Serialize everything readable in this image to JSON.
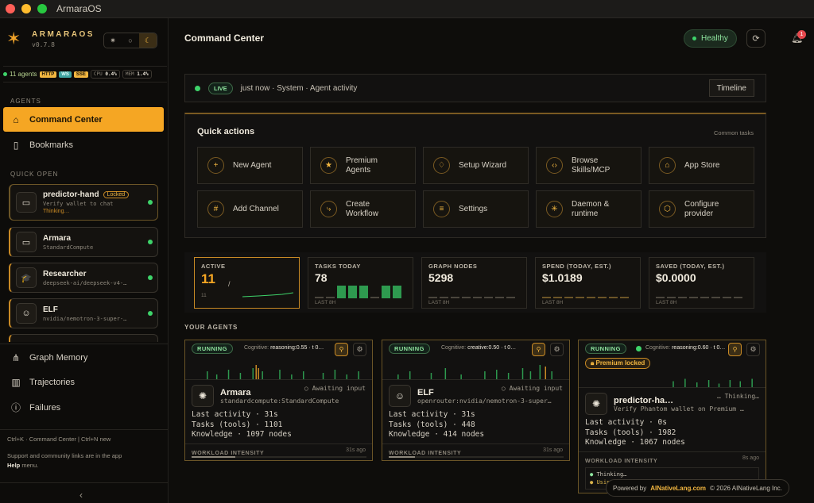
{
  "window": {
    "title": "ArmaraOS"
  },
  "brand": {
    "name": "ARMARAOS",
    "version": "v0.7.8"
  },
  "system": {
    "agents_count": "11 agents",
    "chips": [
      "HTTP",
      "WS",
      "SSE"
    ],
    "cpu_label": "CPU",
    "cpu_value": "0.4%",
    "mem_label": "MEM",
    "mem_value": "1.4%"
  },
  "sidebar": {
    "agents_section": "AGENTS",
    "nav_primary": [
      {
        "label": "Command Center",
        "icon": "home-icon",
        "active": true
      },
      {
        "label": "Bookmarks",
        "icon": "bookmark-icon",
        "active": false
      }
    ],
    "quick_open_section": "QUICK OPEN",
    "quick_open": [
      {
        "name": "predictor-hand",
        "badge": "Locked",
        "sub": "Verify wallet to chat",
        "status": "Thinking…",
        "icon": "chat-icon"
      },
      {
        "name": "Armara",
        "sub": "StandardCompute",
        "icon": "chat-icon"
      },
      {
        "name": "Researcher",
        "sub": "deepseek-ai/deepseek-v4-…",
        "icon": "graduation-cap-icon"
      },
      {
        "name": "ELF",
        "sub": "nvidia/nemotron-3-super-…",
        "icon": "elf-avatar-icon"
      }
    ],
    "nav_secondary": [
      {
        "label": "Graph Memory",
        "icon": "graph-icon"
      },
      {
        "label": "Trajectories",
        "icon": "bar-chart-icon"
      },
      {
        "label": "Failures",
        "icon": "alert-circle-icon"
      }
    ],
    "shortcuts": "Ctrl+K · Command Center | Ctrl+N new",
    "support_text": "Support and community links are in the app",
    "support_bold": "Help",
    "support_tail": " menu."
  },
  "header": {
    "title": "Command Center",
    "health": "Healthy",
    "notifications": "1"
  },
  "live": {
    "pill": "LIVE",
    "text": "just now · System · Agent activity",
    "timeline": "Timeline"
  },
  "quick_actions": {
    "title": "Quick actions",
    "hint": "Common tasks",
    "items": [
      {
        "label": "New Agent",
        "icon": "plus-icon"
      },
      {
        "label": "Premium\nAgents",
        "icon": "star-icon"
      },
      {
        "label": "Setup Wizard",
        "icon": "lightbulb-icon"
      },
      {
        "label": "Browse\nSkills/MCP",
        "icon": "code-icon"
      },
      {
        "label": "App Store",
        "icon": "store-icon"
      },
      {
        "label": "Add Channel",
        "icon": "hash-icon"
      },
      {
        "label": "Create\nWorkflow",
        "icon": "workflow-icon"
      },
      {
        "label": "Settings",
        "icon": "sliders-icon"
      },
      {
        "label": "Daemon &\nruntime",
        "icon": "spinner-icon"
      },
      {
        "label": "Configure\nprovider",
        "icon": "hexagon-icon"
      }
    ]
  },
  "stats": [
    {
      "label": "ACTIVE",
      "value": "11",
      "sub": "11"
    },
    {
      "label": "TASKS TODAY",
      "value": "78",
      "sub": "LAST 8H"
    },
    {
      "label": "GRAPH NODES",
      "value": "5298",
      "sub": "LAST 8H"
    },
    {
      "label": "SPEND (TODAY, EST.)",
      "value": "$1.0189",
      "sub": "LAST 8H"
    },
    {
      "label": "SAVED (TODAY, EST.)",
      "value": "$0.0000",
      "sub": "LAST 8H"
    }
  ],
  "agents_section": "YOUR AGENTS",
  "agents": [
    {
      "status": "RUNNING",
      "cognitive_label": "Cognitive:",
      "cognitive": "reasoning:0.55 · t 0…",
      "name": "Armara",
      "state": "Awaiting input",
      "model": "standardcompute:StandardCompute",
      "last_activity": "Last activity · 31s",
      "tasks": "Tasks (tools) · 1101",
      "knowledge": "Knowledge · 1097 nodes",
      "workload": "WORKLOAD INTENSITY",
      "workload_time": "31s ago",
      "workload_level": 0.25
    },
    {
      "status": "RUNNING",
      "cognitive_label": "Cognitive:",
      "cognitive": "creative:0.50 · t 0…",
      "name": "ELF",
      "state": "Awaiting input",
      "model": "openrouter:nvidia/nemotron-3-super…",
      "last_activity": "Last activity · 31s",
      "tasks": "Tasks (tools) · 448",
      "knowledge": "Knowledge · 414 nodes",
      "workload": "WORKLOAD INTENSITY",
      "workload_time": "31s ago",
      "workload_level": 0.15
    },
    {
      "status": "RUNNING",
      "cognitive_label": "Cognitive:",
      "cognitive": "reasoning:0.60 · t 0…",
      "premium": "Premium locked",
      "name": "predictor-ha…",
      "state": "Thinking…",
      "model": "Verify Phantom wallet on Premium …",
      "last_activity": "Last activity · 0s",
      "tasks": "Tasks (tools) · 1982",
      "knowledge": "Knowledge · 1067 nodes",
      "workload": "WORKLOAD INTENSITY",
      "workload_time": "8s ago",
      "workload_level": 0.1,
      "log": [
        "Thinking…",
        "Using tool: web_search"
      ]
    }
  ],
  "footer": {
    "powered": "Powered by",
    "brand": "AINativeLang.com",
    "copyright": "© 2026 AINativeLang Inc."
  },
  "colors": {
    "accent": "#f5a623",
    "healthy": "#8ee49e",
    "bg": "#0e0d0b"
  }
}
